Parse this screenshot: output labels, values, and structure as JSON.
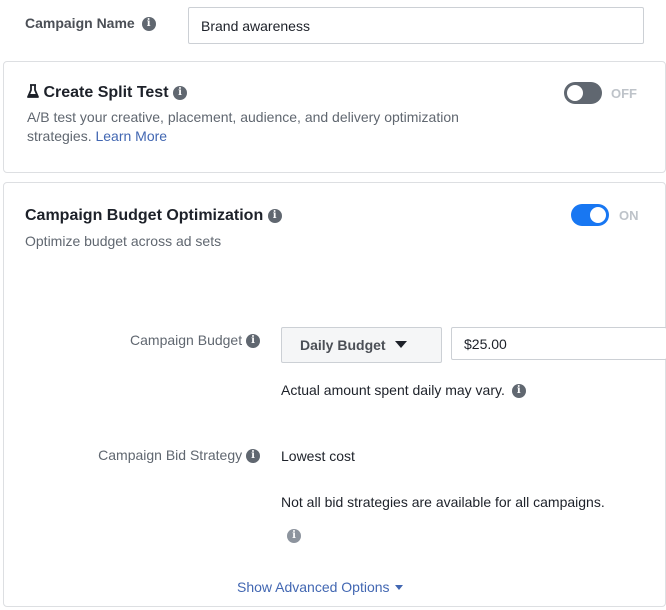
{
  "campaign_name": {
    "label": "Campaign Name",
    "value": "Brand awareness"
  },
  "split_test": {
    "icon": "flask-icon",
    "title": "Create Split Test",
    "description": "A/B test your creative, placement, audience, and delivery optimization",
    "description_line2": "strategies.",
    "learn_more": "Learn More",
    "toggle_state": "OFF"
  },
  "budget_optimization": {
    "title": "Campaign Budget Optimization",
    "subtitle": "Optimize budget across ad sets",
    "toggle_state": "ON",
    "budget_label": "Campaign Budget",
    "budget_type": "Daily Budget",
    "budget_value": "$25.00",
    "budget_note": "Actual amount spent daily may vary.",
    "bid_strategy_label": "Campaign Bid Strategy",
    "bid_strategy_value": "Lowest cost",
    "bid_strategy_note": "Not all bid strategies are available for all campaigns.",
    "advanced_link": "Show Advanced Options"
  },
  "colors": {
    "toggle_on": "#1877f2",
    "toggle_off": "#606770",
    "link": "#4267b2"
  }
}
